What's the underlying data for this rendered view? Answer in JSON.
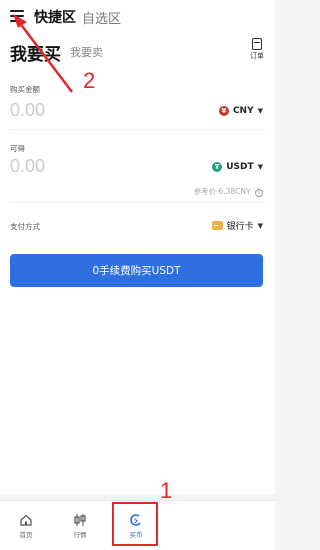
{
  "header": {
    "tabs": [
      {
        "label": "快捷区",
        "active": true
      },
      {
        "label": "自选区",
        "active": false
      }
    ]
  },
  "page": {
    "title": "我要买",
    "alt_tab": "我要卖",
    "orders_label": "订单"
  },
  "form": {
    "amount_label": "购买金额",
    "amount_value": "0.00",
    "amount_currency": "CNY",
    "receive_label": "可得",
    "receive_value": "0.00",
    "receive_currency": "USDT",
    "ref_price": "参考价 6.38CNY",
    "pay_label": "支付方式",
    "pay_value": "银行卡"
  },
  "buy_button": "0手续费购买USDT",
  "bottom_nav": [
    {
      "label": "首页",
      "icon": "home-icon"
    },
    {
      "label": "行情",
      "icon": "candlestick-icon"
    },
    {
      "label": "买币",
      "icon": "buy-coin-icon"
    }
  ],
  "annotations": {
    "label_1": "1",
    "label_2": "2",
    "color": "#e0282a"
  },
  "colors": {
    "primary": "#2f6fe0",
    "cny": "#c0392b",
    "usdt": "#26a17b",
    "bank": "#f0b14a"
  }
}
